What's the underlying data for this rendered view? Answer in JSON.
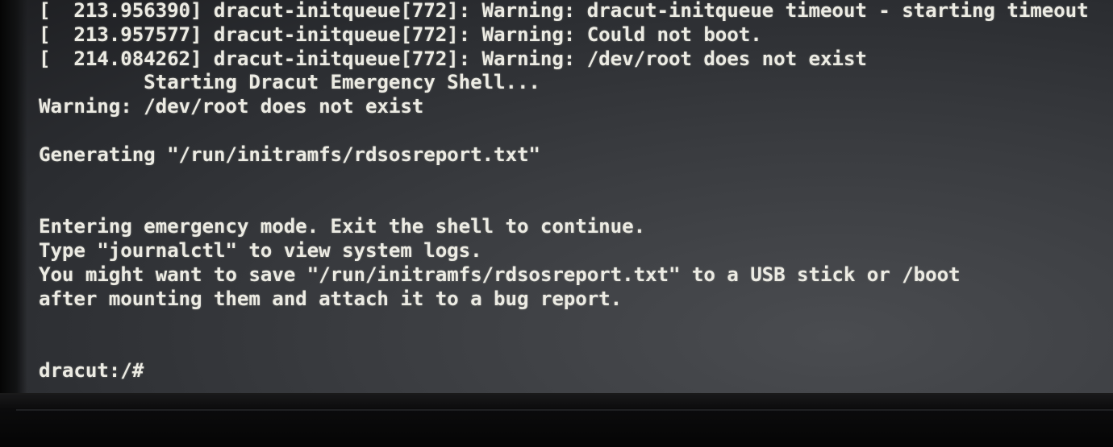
{
  "terminal": {
    "lines": [
      "[  213.956390] dracut-initqueue[772]: Warning: dracut-initqueue timeout - starting timeout",
      "[  213.957577] dracut-initqueue[772]: Warning: Could not boot.",
      "[  214.084262] dracut-initqueue[772]: Warning: /dev/root does not exist",
      "         Starting Dracut Emergency Shell...",
      "Warning: /dev/root does not exist",
      "",
      "Generating \"/run/initramfs/rdsosreport.txt\"",
      "",
      "",
      "Entering emergency mode. Exit the shell to continue.",
      "Type \"journalctl\" to view system logs.",
      "You might want to save \"/run/initramfs/rdsosreport.txt\" to a USB stick or /boot",
      "after mounting them and attach it to a bug report.",
      "",
      "",
      "dracut:/#"
    ],
    "text_color": "#ecebe3",
    "background_color": "#2e3034"
  }
}
